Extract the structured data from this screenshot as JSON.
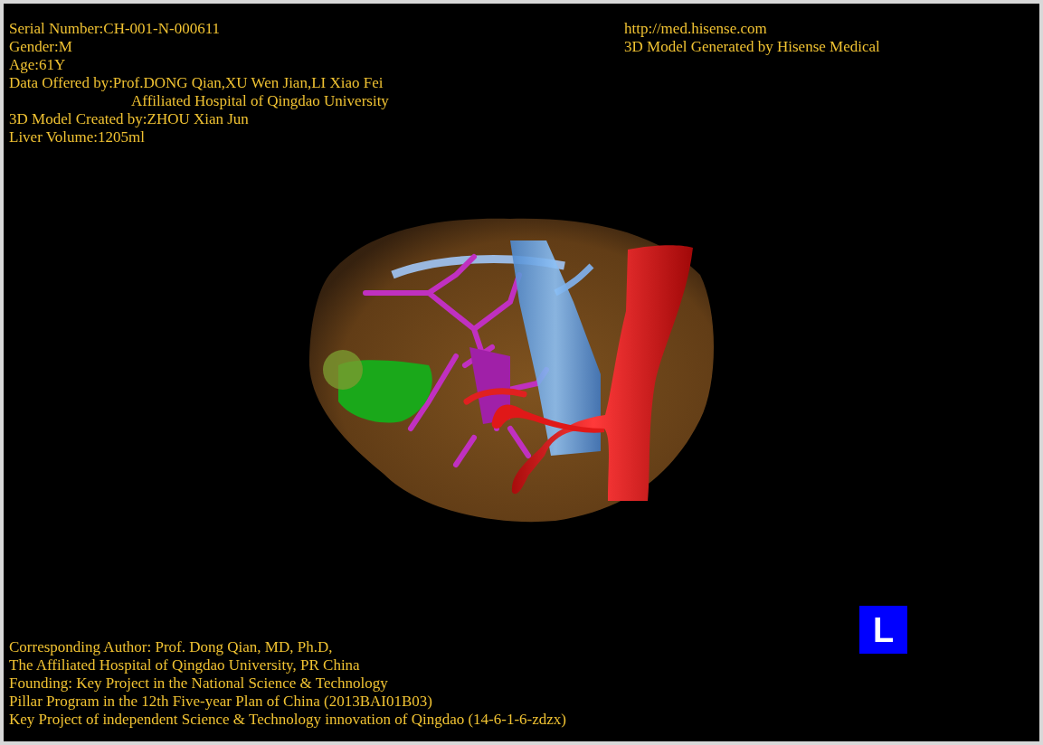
{
  "patient_info": [
    {
      "kind": "field",
      "text": "Serial Number:CH-001-N-000611"
    },
    {
      "kind": "field",
      "text": "Gender:M"
    },
    {
      "kind": "field",
      "text": "Age:61Y"
    },
    {
      "kind": "field",
      "text": "Data Offered by:Prof.DONG Qian,XU Wen Jian,LI Xiao Fei"
    },
    {
      "kind": "continuation",
      "text": "Affiliated Hospital of Qingdao University"
    },
    {
      "kind": "field",
      "text": "3D Model Created by:ZHOU Xian Jun"
    },
    {
      "kind": "field",
      "text": "Liver Volume:1205ml"
    }
  ],
  "source_info": [
    "http://med.hisense.com",
    "3D Model Generated by Hisense Medical"
  ],
  "credits": [
    "Corresponding Author: Prof. Dong Qian, MD, Ph.D,",
    "The Affiliated Hospital of Qingdao University, PR China",
    "Founding: Key Project in the National Science & Technology",
    "Pillar Program in the 12th Five-year Plan of China (2013BAI01B03)",
    "Key Project of independent Science & Technology innovation of Qingdao (14-6-1-6-zdzx)"
  ],
  "orientation_marker": "L"
}
